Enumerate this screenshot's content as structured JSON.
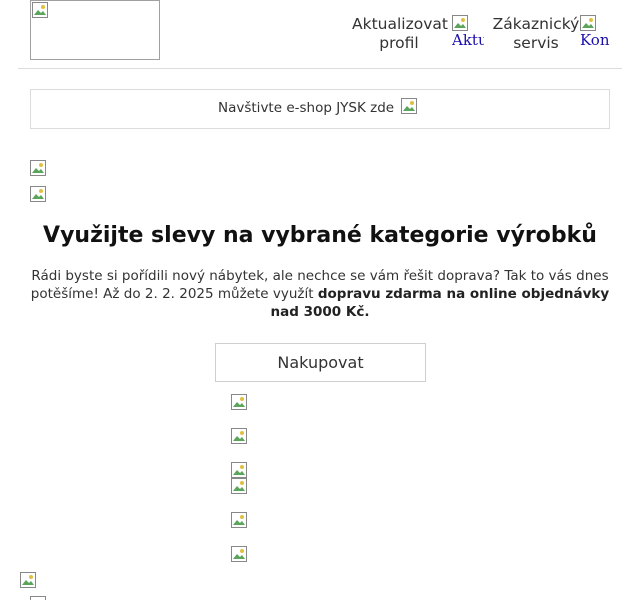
{
  "header": {
    "update_profile_label_1": "Aktualizovat",
    "update_profile_label_2": "profil",
    "update_profile_icon_alt": "Aktu",
    "customer_service_label_1": "Zákaznický",
    "customer_service_label_2": "servis",
    "customer_service_icon_alt": "Kont"
  },
  "eshop_bar": {
    "text": "Navštivte e-shop JYSK zde"
  },
  "promo": {
    "title": "Využijte slevy na vybrané kategorie výrobků",
    "desc_part1": "Rádi byste si pořídili nový nábytek, ale nechce se vám řešit doprava? Tak to vás dnes potěšíme! Až do 2. 2. 2025 můžete využít ",
    "desc_bold": "dopravu zdarma na online objednávky nad 3000 Kč.",
    "button_label": "Nakupovat"
  }
}
